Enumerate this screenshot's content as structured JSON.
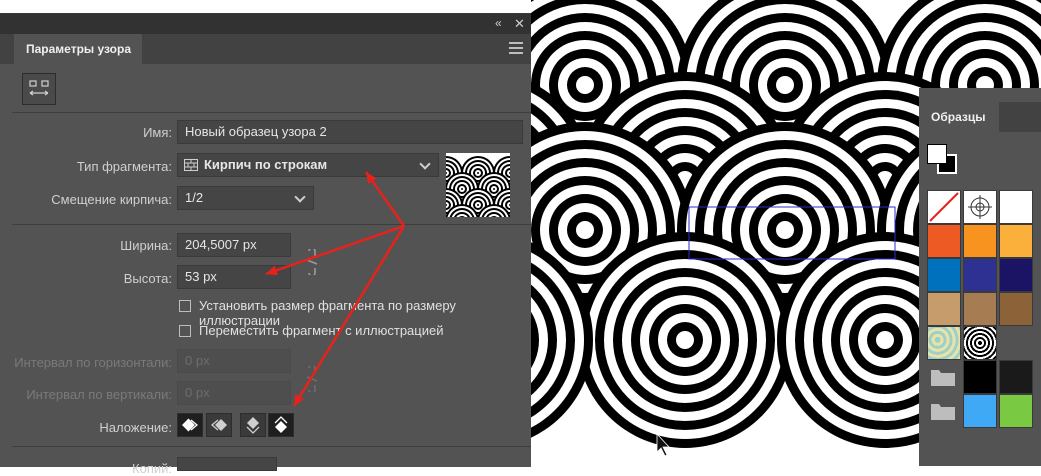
{
  "panel": {
    "title": "Параметры узора",
    "name_label": "Имя:",
    "name_value": "Новый образец узора 2",
    "tile_type_label": "Тип фрагмента:",
    "tile_type_value": "Кирпич по строкам",
    "brick_offset_label": "Смещение кирпича:",
    "brick_offset_value": "1/2",
    "width_label": "Ширина:",
    "width_value": "204,5007 px",
    "height_label": "Высота:",
    "height_value": "53 px",
    "checkbox_size_to_art": "Установить размер фрагмента по размеру иллюстрации",
    "checkbox_move_tile": "Переместить фрагмент с иллюстрацией",
    "h_spacing_label": "Интервал по горизонтали:",
    "h_spacing_value": "0 px",
    "v_spacing_label": "Интервал по вертикали:",
    "v_spacing_value": "0 px",
    "overlap_label": "Наложение:",
    "copies_label": "Копий:"
  },
  "swatches": {
    "title": "Образцы",
    "colors": [
      "#ffffff",
      "#ffffff",
      "#ffffff",
      "#ee5a24",
      "#f7931e",
      "#fbb03b",
      "#0071bc",
      "#2e3192",
      "#1b1464",
      "#c69c6d",
      "#a67c52",
      "#8c6239",
      "#000000",
      "#1a1a1a",
      "#3fa9f5",
      "#7ac943"
    ]
  },
  "annotation_color": "#e8221b",
  "accent_color": "#1f1f1f"
}
